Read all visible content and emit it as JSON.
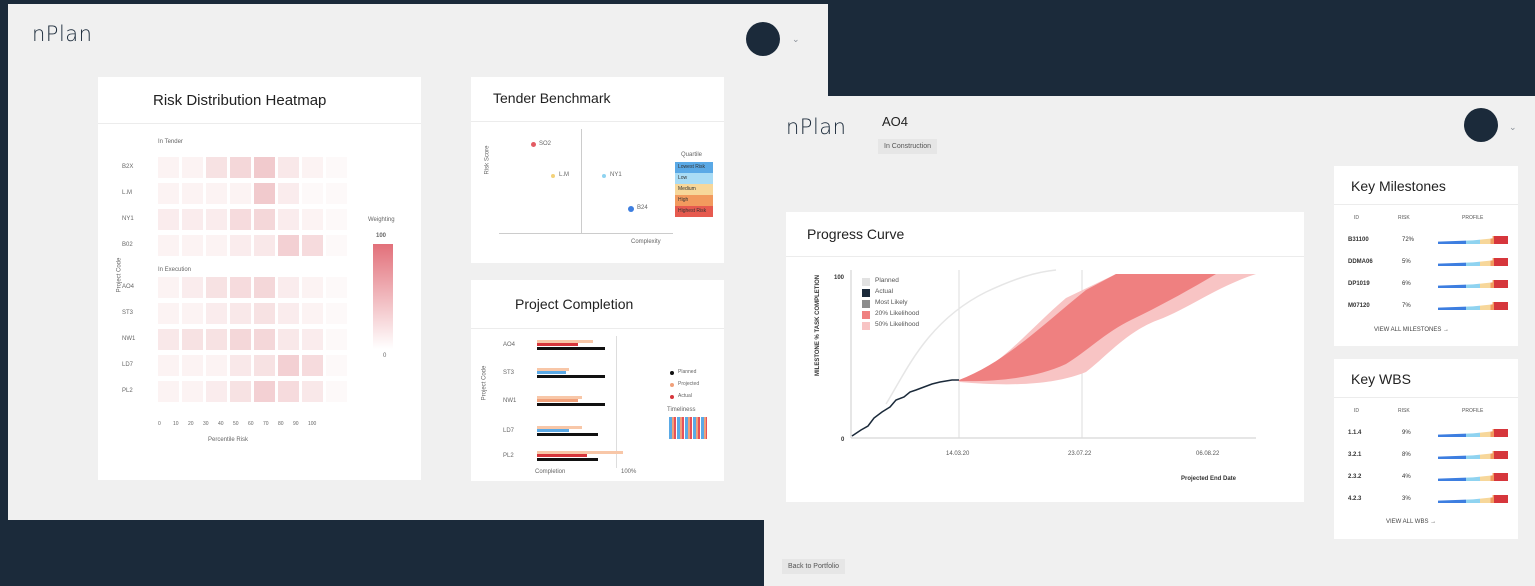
{
  "left_window": {
    "logo": "nPlan",
    "heatmap": {
      "title": "Risk Distribution Heatmap",
      "section1": "In Tender",
      "section2": "In Execution",
      "rows": [
        "B2X",
        "L.M",
        "NY1",
        "B02",
        "AO4",
        "ST3",
        "NW1",
        "LD7",
        "PL2"
      ],
      "intensities": [
        [
          0.05,
          0.05,
          0.2,
          0.3,
          0.4,
          0.15,
          0.05,
          0.0
        ],
        [
          0.05,
          0.05,
          0.05,
          0.05,
          0.4,
          0.1,
          0.0,
          0.0
        ],
        [
          0.1,
          0.1,
          0.1,
          0.25,
          0.3,
          0.1,
          0.05,
          0.0
        ],
        [
          0.05,
          0.05,
          0.05,
          0.1,
          0.15,
          0.35,
          0.25,
          0.0
        ],
        [
          0.05,
          0.1,
          0.2,
          0.25,
          0.3,
          0.1,
          0.05,
          0.0
        ],
        [
          0.05,
          0.05,
          0.1,
          0.15,
          0.2,
          0.1,
          0.05,
          0.0
        ],
        [
          0.15,
          0.2,
          0.2,
          0.3,
          0.3,
          0.15,
          0.1,
          0.0
        ],
        [
          0.05,
          0.05,
          0.05,
          0.15,
          0.2,
          0.35,
          0.25,
          0.0
        ],
        [
          0.05,
          0.05,
          0.1,
          0.2,
          0.35,
          0.25,
          0.15,
          0.0
        ]
      ],
      "x_ticks": [
        "0",
        "10",
        "20",
        "30",
        "40",
        "50",
        "60",
        "70",
        "80",
        "90",
        "100"
      ],
      "y_axis_label": "Project Code",
      "x_axis_label": "Percentile Risk",
      "legend_title": "Weighting",
      "legend_max": "100",
      "legend_min": "0"
    },
    "tender": {
      "title": "Tender Benchmark",
      "y_axis_label": "Risk Score",
      "x_axis_label": "Complexity",
      "points": [
        {
          "label": "SO2",
          "color": "#e35b63"
        },
        {
          "label": "L.M",
          "color": "#f3d27a"
        },
        {
          "label": "NY1",
          "color": "#8fd3f0"
        },
        {
          "label": "B24",
          "color": "#3d7ee0"
        }
      ],
      "legend_title": "Quartile",
      "legend_items": [
        "Lowest Risk",
        "Low",
        "Medium",
        "High",
        "Highest Risk"
      ],
      "legend_colors": [
        "#5aa9e6",
        "#a9dcf5",
        "#f7d79a",
        "#f29a5e",
        "#e65a4f"
      ]
    },
    "completion": {
      "title": "Project Completion",
      "rows": [
        "AO4",
        "ST3",
        "NW1",
        "LD7",
        "PL2"
      ],
      "y_axis_label": "Project Code",
      "x_axis_label": "Completion",
      "x_tick_right": "100%",
      "legend": [
        {
          "label": "Planned",
          "color": "#111111"
        },
        {
          "label": "Projected",
          "color": "#f0a07a"
        },
        {
          "label": "Actual",
          "color": "#d6363c"
        }
      ],
      "legend2_title": "Timeliness",
      "bars": [
        {
          "planned": 0.5,
          "projected": 0.62,
          "actual": 0.45,
          "blue": 0.0,
          "orange": 0.0
        },
        {
          "planned": 0.5,
          "projected": 0.35,
          "actual": 0.0,
          "blue": 0.32,
          "orange": 0.0
        },
        {
          "planned": 0.5,
          "projected": 0.5,
          "actual": 0.0,
          "blue": 0.0,
          "orange": 0.45
        },
        {
          "planned": 0.45,
          "projected": 0.5,
          "actual": 0.0,
          "blue": 0.35,
          "orange": 0.0
        },
        {
          "planned": 0.45,
          "projected": 0.95,
          "actual": 0.55,
          "blue": 0.0,
          "orange": 0.0
        }
      ]
    }
  },
  "right_window": {
    "logo": "nPlan",
    "project_title": "AO4",
    "status": "In Construction",
    "progress": {
      "title": "Progress Curve",
      "y_axis_label": "MILESTONE % TASK COMPLETION",
      "y_top": "100",
      "y_bottom": "0",
      "legend": [
        {
          "label": "Planned",
          "color": "#e2e2e2"
        },
        {
          "label": "Actual",
          "color": "#1b2a3a"
        },
        {
          "label": "Most Likely",
          "color": "#8c8c8c"
        },
        {
          "label": "20% Likelihood",
          "color": "#ef8080"
        },
        {
          "label": "50% Likelihood",
          "color": "#f8c4c4"
        }
      ],
      "x_ticks": [
        "14.03.20",
        "23.07.22",
        "06.08.22"
      ],
      "x_axis_label": "Projected End Date"
    },
    "milestones": {
      "title": "Key Milestones",
      "headers": [
        "ID",
        "RISK",
        "PROFILE"
      ],
      "rows": [
        {
          "id": "B31100",
          "risk": "72%"
        },
        {
          "id": "DDMA06",
          "risk": "5%"
        },
        {
          "id": "DP1019",
          "risk": "6%"
        },
        {
          "id": "M07120",
          "risk": "7%"
        }
      ],
      "view_all": "VIEW ALL MILESTONES →"
    },
    "wbs": {
      "title": "Key WBS",
      "headers": [
        "ID",
        "RISK",
        "PROFILE"
      ],
      "rows": [
        {
          "id": "1.1.4",
          "risk": "9%"
        },
        {
          "id": "3.2.1",
          "risk": "8%"
        },
        {
          "id": "2.3.2",
          "risk": "4%"
        },
        {
          "id": "4.2.3",
          "risk": "3%"
        }
      ],
      "view_all": "VIEW ALL WBS →"
    },
    "back_button": "Back to Portfolio"
  }
}
